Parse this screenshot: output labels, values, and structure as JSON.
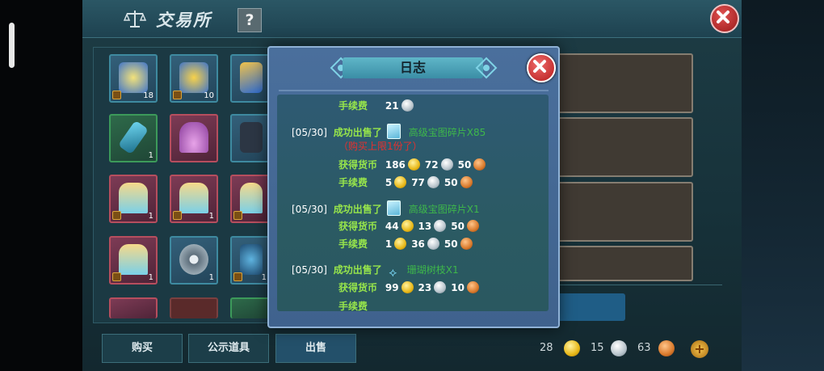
{
  "background": {
    "title": "交易所",
    "help_label": "?",
    "inventory_counts": [
      "18",
      "10",
      "1",
      "1",
      "1",
      "1",
      "1",
      "1"
    ],
    "buttons": {
      "buy": "购买",
      "public": "公示道具",
      "sell": "出售"
    },
    "currency": {
      "gold": "28",
      "silver": "15",
      "copper": "63",
      "add": "+"
    }
  },
  "modal": {
    "title": "日志",
    "entries": [
      {
        "fee_label": "手续费",
        "fee": [
          "21"
        ]
      },
      {
        "date": "[05/30]",
        "action": "成功出售了",
        "item": "高级宝图碎片X85",
        "note": "（购买上限1份了）",
        "earned_label": "获得货币",
        "earned": [
          "186",
          "72",
          "50"
        ],
        "fee_label": "手续费",
        "fee": [
          "5",
          "77",
          "50"
        ]
      },
      {
        "date": "[05/30]",
        "action": "成功出售了",
        "item": "高级宝图碎片X1",
        "earned_label": "获得货币",
        "earned": [
          "44",
          "13",
          "50"
        ],
        "fee_label": "手续费",
        "fee": [
          "1",
          "36",
          "50"
        ]
      },
      {
        "date": "[05/30]",
        "action": "成功出售了",
        "item": "珊瑚树枝X1",
        "earned_label": "获得货币",
        "earned": [
          "99",
          "23",
          "10"
        ],
        "fee_label": "手续费"
      }
    ]
  },
  "colors": {
    "label_green": "#97e54b",
    "item_green": "#3eb84a",
    "warning_red": "#e8302e",
    "close_red": "#c42424"
  },
  "icons": [
    "scale-icon",
    "close-icon",
    "gold-coin-icon",
    "silver-coin-icon",
    "copper-coin-icon",
    "crystal-item-icon",
    "coral-branch-icon"
  ]
}
